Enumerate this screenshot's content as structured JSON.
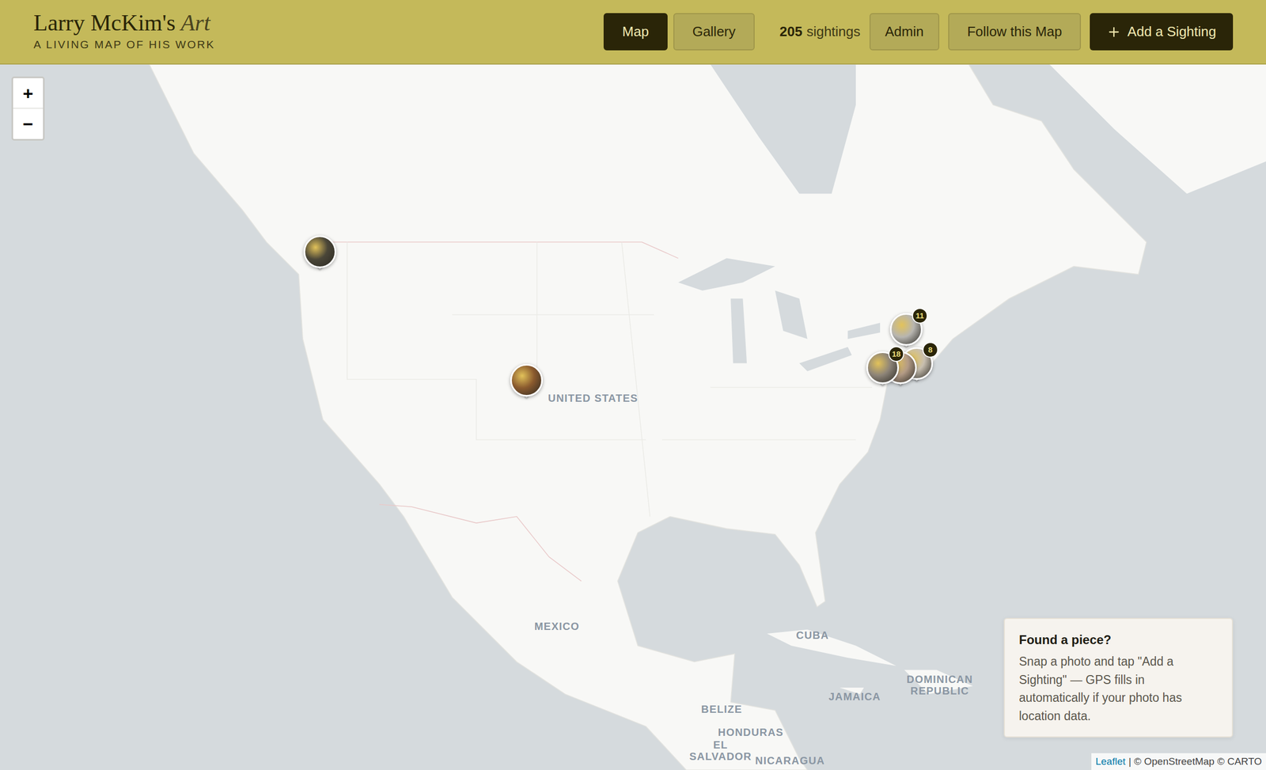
{
  "header": {
    "title": "Larry McKim's",
    "title_accent": "Art",
    "subtitle": "A LIVING MAP OF HIS WORK"
  },
  "nav": [
    {
      "label": "Map",
      "selected": true
    },
    {
      "label": "Gallery",
      "selected": false
    }
  ],
  "sightings": {
    "count": "205",
    "label": "sightings"
  },
  "actions": {
    "admin": "Admin",
    "follow": "Follow this Map",
    "add": "Add a Sighting"
  },
  "zoom": {
    "in": "+",
    "out": "−"
  },
  "map_labels": [
    "UNITED STATES",
    "MEXICO",
    "CUBA",
    "JAMAICA",
    "DOMINICAN REPUBLIC",
    "BELIZE",
    "HONDURAS",
    "EL SALVADOR",
    "NICARAGUA"
  ],
  "pins": [
    {
      "color": "#4a4638",
      "badge": ""
    },
    {
      "color": "#8a5a2e",
      "badge": ""
    },
    {
      "color": "#b7b5b0",
      "badge": "11"
    },
    {
      "color": "#c8bfb0",
      "badge": "8"
    },
    {
      "color": "#b39b86",
      "badge": ""
    },
    {
      "color": "#8d8478",
      "badge": "18"
    }
  ],
  "hint": {
    "title": "Found a piece?",
    "body": "Snap a photo and tap \"Add a Sighting\" — GPS fills in automatically if your photo has location data."
  },
  "attribution": {
    "link": "Leaflet",
    "text": "| © OpenStreetMap © CARTO"
  }
}
